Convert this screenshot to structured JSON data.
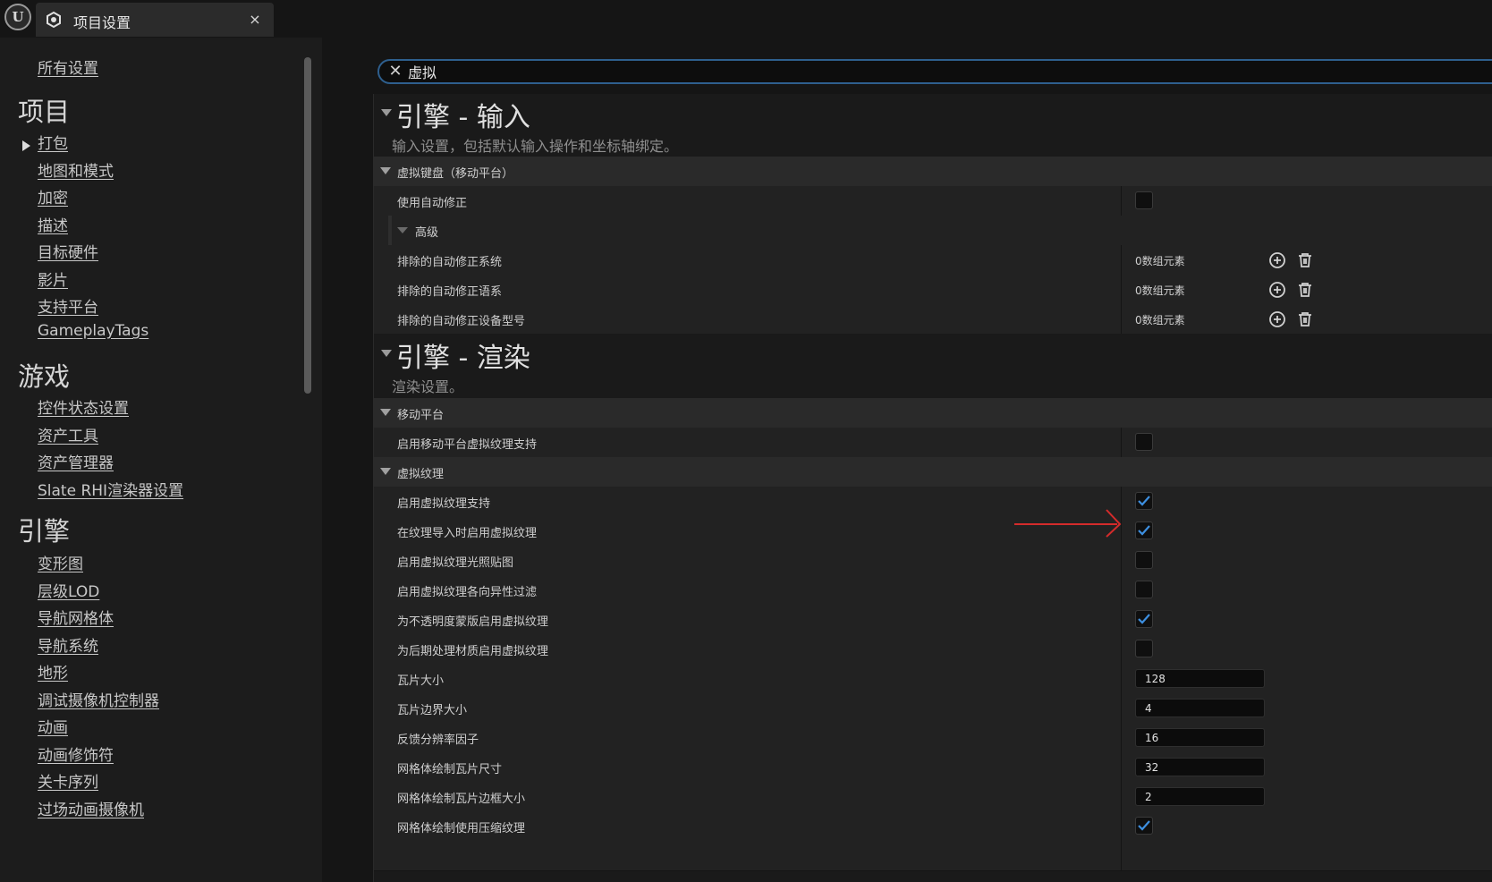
{
  "window": {
    "tab_title": "项目设置",
    "tab_close": "×"
  },
  "search": {
    "value": "虚拟",
    "clear_glyph": "✕"
  },
  "sidebar": {
    "all_settings": "所有设置",
    "categories": {
      "project": {
        "label": "项目",
        "items": [
          "打包",
          "地图和模式",
          "加密",
          "描述",
          "目标硬件",
          "影片",
          "支持平台",
          "GameplayTags"
        ]
      },
      "game": {
        "label": "游戏",
        "items": [
          "控件状态设置",
          "资产工具",
          "资产管理器",
          "Slate RHI渲染器设置"
        ]
      },
      "engine": {
        "label": "引擎",
        "items": [
          "变形图",
          "层级LOD",
          "导航网格体",
          "导航系统",
          "地形",
          "调试摄像机控制器",
          "动画",
          "动画修饰符",
          "关卡序列",
          "过场动画摄像机"
        ]
      }
    }
  },
  "sections": {
    "input": {
      "title": "引擎 - 输入",
      "description": "输入设置，包括默认输入操作和坐标轴绑定。",
      "category": "虚拟键盘（移动平台）",
      "rows": {
        "use_autocorrect": {
          "label": "使用自动修正",
          "checked": false
        },
        "advanced": "高级",
        "excluded_os": {
          "label": "排除的自动修正系统",
          "value": "0数组元素"
        },
        "excluded_lang": {
          "label": "排除的自动修正语系",
          "value": "0数组元素"
        },
        "excluded_device": {
          "label": "排除的自动修正设备型号",
          "value": "0数组元素"
        }
      }
    },
    "render": {
      "title": "引擎 - 渲染",
      "description": "渲染设置。",
      "mobile": {
        "category": "移动平台",
        "rows": [
          {
            "label": "启用移动平台虚拟纹理支持",
            "checked": false
          }
        ]
      },
      "vt": {
        "category": "虚拟纹理",
        "rows": [
          {
            "label": "启用虚拟纹理支持",
            "checked": true
          },
          {
            "label": "在纹理导入时启用虚拟纹理",
            "checked": true
          },
          {
            "label": "启用虚拟纹理光照贴图",
            "checked": false
          },
          {
            "label": "启用虚拟纹理各向异性过滤",
            "checked": false
          },
          {
            "label": "为不透明度蒙版启用虚拟纹理",
            "checked": true
          },
          {
            "label": "为后期处理材质启用虚拟纹理",
            "checked": false
          },
          {
            "label": "瓦片大小",
            "value": "128"
          },
          {
            "label": "瓦片边界大小",
            "value": "4"
          },
          {
            "label": "反馈分辨率因子",
            "value": "16"
          },
          {
            "label": "网格体绘制瓦片尺寸",
            "value": "32"
          },
          {
            "label": "网格体绘制瓦片边框大小",
            "value": "2"
          },
          {
            "label": "网格体绘制使用压缩纹理",
            "checked": true
          }
        ]
      }
    }
  },
  "colors": {
    "check": "#3d8fe0",
    "annotation": "#d42b2b",
    "search_border": "#2e5f8e"
  },
  "icons": {
    "add": "plus-circle-icon",
    "delete": "trash-icon",
    "settings": "gear-icon",
    "logo": "unreal-logo-icon"
  }
}
